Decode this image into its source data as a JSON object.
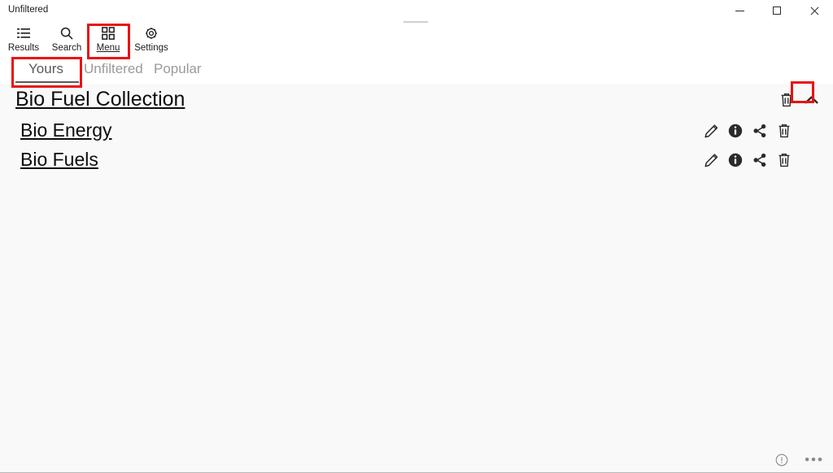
{
  "window": {
    "title": "Unfiltered",
    "caption": {
      "minimize": "minimize-icon",
      "maximize": "maximize-icon",
      "close": "close-icon"
    }
  },
  "media_pill": {
    "icon": "media-bar-icon"
  },
  "commandbar": {
    "items": [
      {
        "label": "Results",
        "icon": "list-icon",
        "selected": false
      },
      {
        "label": "Search",
        "icon": "search-icon",
        "selected": false
      },
      {
        "label": "Menu",
        "icon": "grid-icon",
        "selected": true
      },
      {
        "label": "Settings",
        "icon": "gear-icon",
        "selected": false
      }
    ]
  },
  "tabs": {
    "items": [
      {
        "label": "Yours",
        "selected": true
      },
      {
        "label": "Unfiltered",
        "selected": false
      },
      {
        "label": "Popular",
        "selected": false
      }
    ]
  },
  "content": {
    "collection": {
      "title": "Bio Fuel Collection",
      "actions": [
        {
          "name": "delete",
          "icon": "trash-icon"
        },
        {
          "name": "collapse",
          "icon": "chevron-up-icon"
        }
      ],
      "items": [
        {
          "title": "Bio Energy",
          "actions": [
            {
              "name": "edit",
              "icon": "pencil-icon"
            },
            {
              "name": "info",
              "icon": "info-icon"
            },
            {
              "name": "share",
              "icon": "share-icon"
            },
            {
              "name": "delete",
              "icon": "trash-icon"
            }
          ]
        },
        {
          "title": "Bio Fuels",
          "actions": [
            {
              "name": "edit",
              "icon": "pencil-icon"
            },
            {
              "name": "info",
              "icon": "info-icon"
            },
            {
              "name": "share",
              "icon": "share-icon"
            },
            {
              "name": "delete",
              "icon": "trash-icon"
            }
          ]
        }
      ]
    }
  },
  "statusbar": {
    "info_icon": "info-circle-icon",
    "more_label": "•••"
  },
  "annotations": {
    "highlight_color": "#e81313",
    "boxes": [
      {
        "target": "menu-command"
      },
      {
        "target": "yours-tab"
      },
      {
        "target": "collection-collapse-button"
      }
    ]
  }
}
